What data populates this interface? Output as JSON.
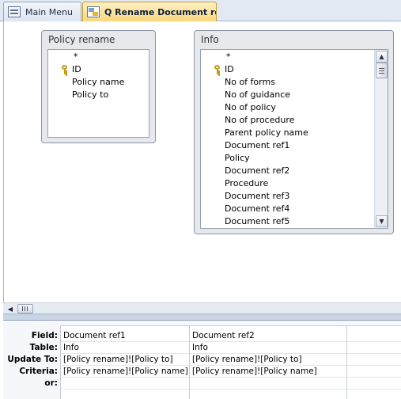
{
  "tabs": [
    {
      "label": "Main Menu",
      "icon": "form-icon",
      "active": false
    },
    {
      "label": "Q Rename Document refs",
      "icon": "query-icon",
      "active": true
    }
  ],
  "tables": {
    "policy_rename": {
      "title": "Policy rename",
      "fields": [
        "*",
        "ID",
        "Policy name",
        "Policy to"
      ]
    },
    "info": {
      "title": "Info",
      "fields": [
        "*",
        "ID",
        "No of forms",
        "No of guidance",
        "No of policy",
        "No of procedure",
        "Parent policy name",
        "Document ref1",
        "Policy",
        "Document ref2",
        "Procedure",
        "Document ref3",
        "Document ref4",
        "Document ref5"
      ]
    }
  },
  "grid": {
    "row_labels": {
      "field": "Field:",
      "table": "Table:",
      "update_to": "Update To:",
      "criteria": "Criteria:",
      "or": "or:"
    },
    "columns": [
      {
        "field": "Document ref1",
        "table": "Info",
        "update_to": "[Policy rename]![Policy to]",
        "criteria": "[Policy rename]![Policy name]",
        "or": ""
      },
      {
        "field": "Document ref2",
        "table": "Info",
        "update_to": "[Policy rename]![Policy to]",
        "criteria": "[Policy rename]![Policy name]",
        "or": ""
      },
      {
        "field": "",
        "table": "",
        "update_to": "",
        "criteria": "",
        "or": ""
      }
    ]
  },
  "colors": {
    "active_tab": "#f8d77c",
    "tab_strip": "#e2e9f2",
    "table_box": "#e6e8ec",
    "key_icon": "#c79a19"
  }
}
